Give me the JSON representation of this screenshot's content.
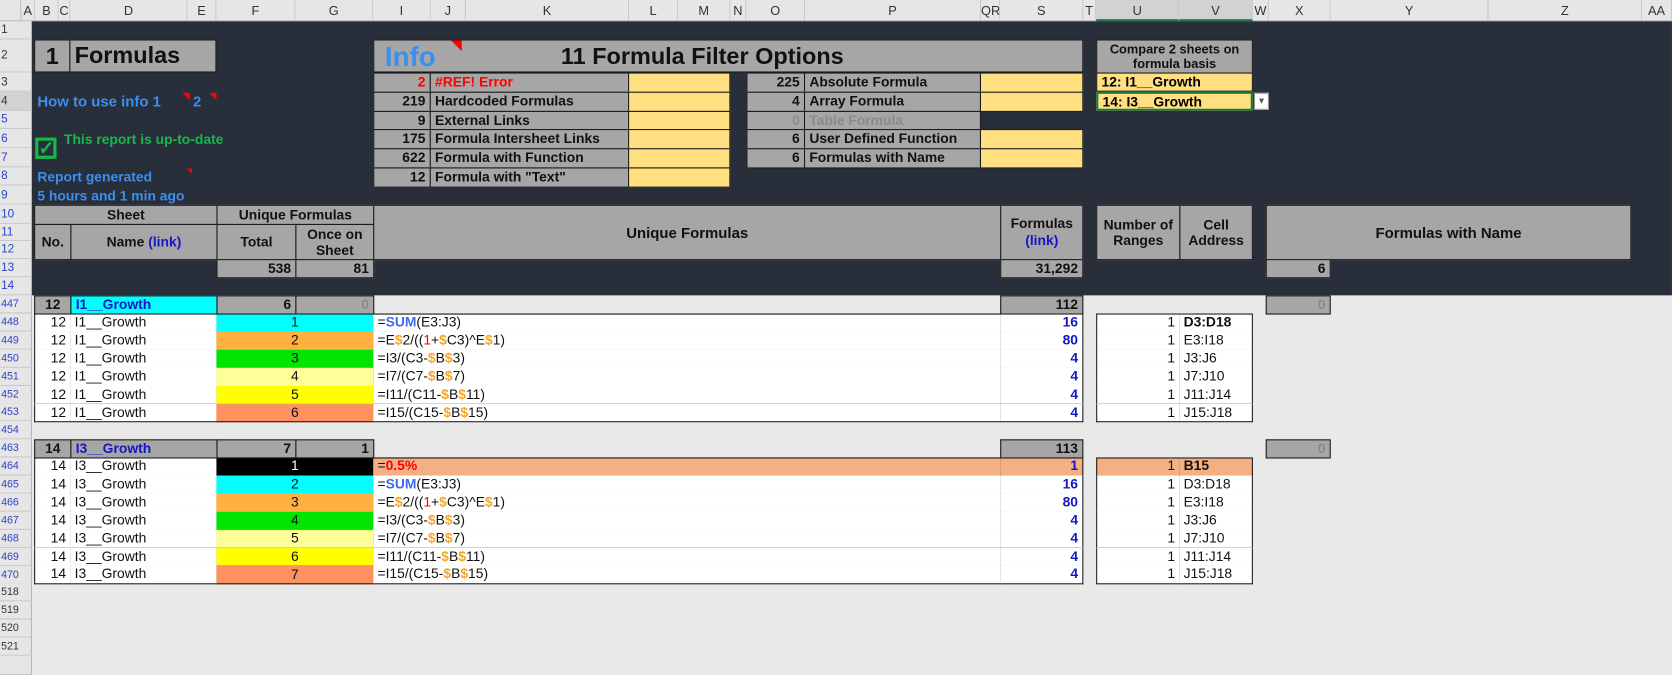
{
  "columns": [
    "A",
    "B",
    "C",
    "D",
    "E",
    "F",
    "G",
    "I",
    "J",
    "K",
    "L",
    "M",
    "N",
    "O",
    "P",
    "QR",
    "S",
    "T",
    "U",
    "V",
    "W",
    "X",
    "Y",
    "Z",
    "AA"
  ],
  "rows_top": [
    "1",
    "2",
    "3",
    "4",
    "5",
    "6",
    "7",
    "8",
    "9",
    "10",
    "11",
    "12",
    "13",
    "14"
  ],
  "rows_bottom": [
    "447",
    "448",
    "449",
    "450",
    "451",
    "452",
    "453",
    "454",
    "463",
    "464",
    "465",
    "466",
    "467",
    "468",
    "469",
    "470",
    "518",
    "519",
    "520",
    "521"
  ],
  "title": {
    "number": "1",
    "label": "Formulas"
  },
  "how_to": {
    "label": "How to use info 1",
    "label2": "2"
  },
  "status": {
    "icon": "checkbox-checked-icon",
    "text": "This report is up-to-date"
  },
  "report": {
    "line1": "Report generated",
    "line2": "5 hours and 1 min ago"
  },
  "info": {
    "badge": "Info",
    "title": "11 Formula Filter Options",
    "left": [
      {
        "count": "2",
        "label": "#REF! Error"
      },
      {
        "count": "219",
        "label": "Hardcoded Formulas"
      },
      {
        "count": "9",
        "label": "External Links"
      },
      {
        "count": "175",
        "label": "Formula Intersheet Links"
      },
      {
        "count": "622",
        "label": "Formula with Function"
      },
      {
        "count": "12",
        "label": "Formula with \"Text\""
      }
    ],
    "right": [
      {
        "count": "225",
        "label": "Absolute Formula"
      },
      {
        "count": "4",
        "label": "Array Formula"
      },
      {
        "count": "0",
        "label": "Table Formula"
      },
      {
        "count": "6",
        "label": "User Defined Function"
      },
      {
        "count": "6",
        "label": "Formulas with Name"
      }
    ]
  },
  "compare": {
    "title": "Compare 2 sheets on formula basis",
    "sheet1": "12:  I1__Growth",
    "sheet2": "14:  I3__Growth"
  },
  "header": {
    "sheet": "Sheet",
    "no": "No.",
    "name": "Name",
    "name_link": "(link)",
    "unique_group": "Unique Formulas",
    "total": "Total",
    "once": "Once on Sheet",
    "unique_formulas": "Unique Formulas",
    "formulas": "Formulas",
    "formulas_link": "(link)",
    "ranges": "Number of Ranges",
    "address": "Cell Address",
    "with_name": "Formulas with Name"
  },
  "totals": {
    "total": "538",
    "once": "81",
    "formulas": "31,292",
    "with_name": "6"
  },
  "colors": {
    "dark_bg": "#282e3a",
    "header_grey": "#a6a6a6",
    "yellow": "#ffdf80",
    "info_blue": "#3b8ff0",
    "green": "#16b84a",
    "red": "#ff0000"
  },
  "groups": [
    {
      "no": "12",
      "name": "I1__Growth",
      "name_bg": "#00ffff",
      "total": "6",
      "once": "0",
      "formulas": "112",
      "with_name": "0",
      "rows": [
        {
          "no": "12",
          "name": "I1__Growth",
          "idx": "1",
          "color": "#00ffff",
          "formula": "=SUM(E3:J3)",
          "count": "16",
          "ranges": "1",
          "address": "D3:D18",
          "address_bold": true
        },
        {
          "no": "12",
          "name": "I1__Growth",
          "idx": "2",
          "color": "#ffb040",
          "formula": "=E$2/((1+$C3)^E$1)",
          "count": "80",
          "ranges": "1",
          "address": "E3:I18"
        },
        {
          "no": "12",
          "name": "I1__Growth",
          "idx": "3",
          "color": "#00e600",
          "formula": "=I3/(C3-$B$3)",
          "count": "4",
          "ranges": "1",
          "address": "J3:J6"
        },
        {
          "no": "12",
          "name": "I1__Growth",
          "idx": "4",
          "color": "#ffff99",
          "formula": "=I7/(C7-$B$7)",
          "count": "4",
          "ranges": "1",
          "address": "J7:J10"
        },
        {
          "no": "12",
          "name": "I1__Growth",
          "idx": "5",
          "color": "#ffff00",
          "formula": "=I11/(C11-$B$11)",
          "count": "4",
          "ranges": "1",
          "address": "J11:J14"
        },
        {
          "no": "12",
          "name": "I1__Growth",
          "idx": "6",
          "color": "#ff9060",
          "formula": "=I15/(C15-$B$15)",
          "count": "4",
          "ranges": "1",
          "address": "J15:J18"
        }
      ]
    },
    {
      "no": "14",
      "name": "I3__Growth",
      "name_bg": "#a6a6a6",
      "total": "7",
      "once": "1",
      "formulas": "113",
      "with_name": "0",
      "rows": [
        {
          "no": "14",
          "name": "I3__Growth",
          "idx": "1",
          "color": "#000000",
          "formula": "=0.5%",
          "count": "1",
          "ranges": "1",
          "address": "B15",
          "address_bold": true,
          "highlight": "#f4b084"
        },
        {
          "no": "14",
          "name": "I3__Growth",
          "idx": "2",
          "color": "#00ffff",
          "formula": "=SUM(E3:J3)",
          "count": "16",
          "ranges": "1",
          "address": "D3:D18"
        },
        {
          "no": "14",
          "name": "I3__Growth",
          "idx": "3",
          "color": "#ffb040",
          "formula": "=E$2/((1+$C3)^E$1)",
          "count": "80",
          "ranges": "1",
          "address": "E3:I18"
        },
        {
          "no": "14",
          "name": "I3__Growth",
          "idx": "4",
          "color": "#00e600",
          "formula": "=I3/(C3-$B$3)",
          "count": "4",
          "ranges": "1",
          "address": "J3:J6"
        },
        {
          "no": "14",
          "name": "I3__Growth",
          "idx": "5",
          "color": "#ffff99",
          "formula": "=I7/(C7-$B$7)",
          "count": "4",
          "ranges": "1",
          "address": "J7:J10"
        },
        {
          "no": "14",
          "name": "I3__Growth",
          "idx": "6",
          "color": "#ffff00",
          "formula": "=I11/(C11-$B$11)",
          "count": "4",
          "ranges": "1",
          "address": "J11:J14"
        },
        {
          "no": "14",
          "name": "I3__Growth",
          "idx": "7",
          "color": "#ff9060",
          "formula": "=I15/(C15-$B$15)",
          "count": "4",
          "ranges": "1",
          "address": "J15:J18"
        }
      ]
    }
  ]
}
